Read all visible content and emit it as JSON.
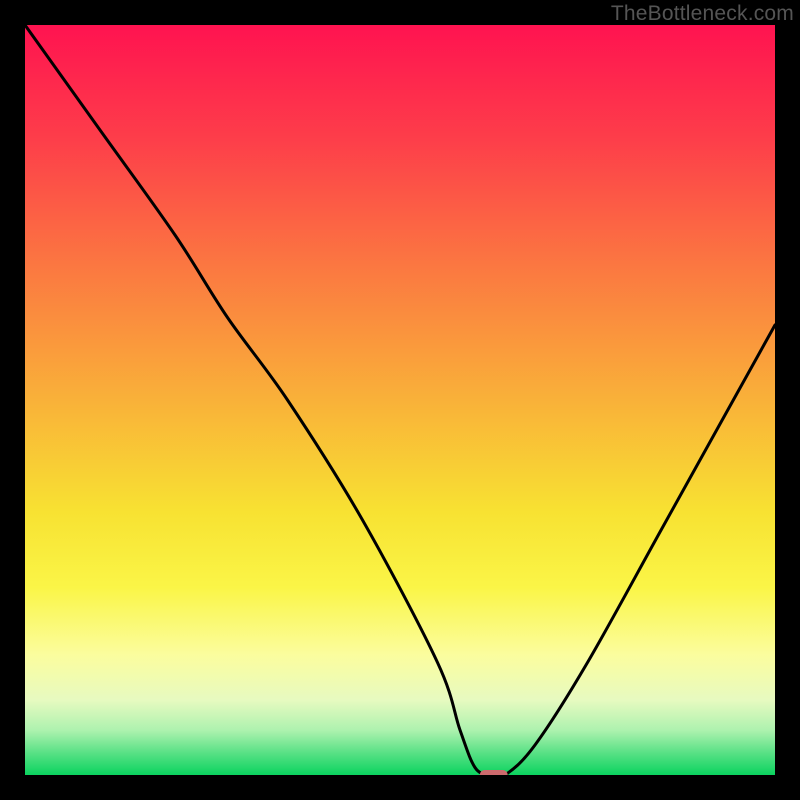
{
  "watermark": "TheBottleneck.com",
  "chart_data": {
    "type": "line",
    "title": "",
    "xlabel": "",
    "ylabel": "",
    "xlim": [
      0,
      100
    ],
    "ylim": [
      0,
      100
    ],
    "grid": false,
    "legend": false,
    "series": [
      {
        "name": "curve",
        "x": [
          0,
          10,
          20,
          27,
          35,
          45,
          55,
          58,
          60,
          62,
          64,
          68,
          75,
          85,
          95,
          100
        ],
        "y": [
          100,
          86,
          72,
          61,
          50,
          34,
          15,
          6,
          1,
          0,
          0,
          4,
          15,
          33,
          51,
          60
        ]
      }
    ],
    "marker": {
      "x": 62.5,
      "y": 0,
      "color": "#cd6a6d"
    },
    "gradient_stops": [
      {
        "pct": 0,
        "color": "#ff1350"
      },
      {
        "pct": 15,
        "color": "#fd3d4a"
      },
      {
        "pct": 32,
        "color": "#fb7741"
      },
      {
        "pct": 50,
        "color": "#f9b139"
      },
      {
        "pct": 65,
        "color": "#f8e232"
      },
      {
        "pct": 75,
        "color": "#faf547"
      },
      {
        "pct": 84,
        "color": "#fbfd9e"
      },
      {
        "pct": 90,
        "color": "#e7fac0"
      },
      {
        "pct": 94,
        "color": "#aef2af"
      },
      {
        "pct": 97,
        "color": "#5ae186"
      },
      {
        "pct": 100,
        "color": "#0bd35f"
      }
    ]
  }
}
